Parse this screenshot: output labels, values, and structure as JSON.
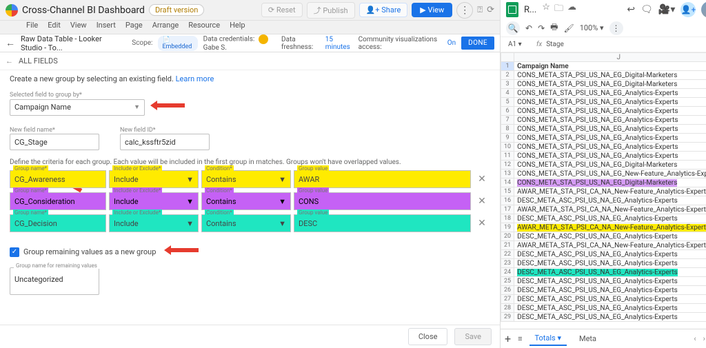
{
  "looker": {
    "title": "Cross-Channel BI Dashboard",
    "draft": "Draft version",
    "menus": [
      "File",
      "Edit",
      "View",
      "Insert",
      "Page",
      "Arrange",
      "Resource",
      "Help"
    ],
    "reset": "Reset",
    "publish": "Publish",
    "share": "Share",
    "view": "View",
    "datasource": "Raw Data Table - Looker Studio - To...",
    "scope_lbl": "Scope:",
    "scope_val": "Embedded",
    "cred_lbl": "Data credentials:",
    "cred_name": "Gabe S.",
    "fresh_lbl": "Data freshness:",
    "fresh_val": "15 minutes",
    "viz_lbl": "Community visualizations access:",
    "viz_val": "On",
    "done": "DONE",
    "all_fields": "ALL FIELDS",
    "desc": "Create a new group by selecting an existing field.",
    "learn": "Learn more",
    "sel_lbl": "Selected field to group by*",
    "sel_val": "Campaign Name",
    "nf_name_lbl": "New field name*",
    "nf_name_val": "CG_Stage",
    "nf_id_lbl": "New field ID*",
    "nf_id_val": "calc_kssftr5zid",
    "crit": "Define the criteria for each group. Each value will be included in the first group in matches. Groups won't have overlapped values.",
    "col": {
      "name": "Group name*",
      "ie": "Include or Exclude*",
      "cond": "Condition*",
      "val": "Group value"
    },
    "groups": [
      {
        "cls": "g-yellow",
        "name": "CG_Awareness",
        "ie": "Include",
        "cond": "Contains",
        "val": "AWAR"
      },
      {
        "cls": "g-purple",
        "name": "CG_Consideration",
        "ie": "Include",
        "cond": "Contains",
        "val": "CONS"
      },
      {
        "cls": "g-teal",
        "name": "CG_Decision",
        "ie": "Include",
        "cond": "Contains",
        "val": "DESC"
      }
    ],
    "remain_lbl": "Group remaining values as a new group",
    "remain_name_lbl": "Group name for remaining values",
    "remain_name_val": "Uncategorized",
    "close": "Close",
    "save": "Save"
  },
  "sheets": {
    "title": "R...",
    "zoom": "100%",
    "cellref": "A1",
    "fx_val": "Stage",
    "colJ": "J",
    "header": "Campaign Name",
    "rows": [
      {
        "n": 2,
        "t": "CONS_META_STA_PSI_US_NA_EG_Digital-Marketers"
      },
      {
        "n": 3,
        "t": "CONS_META_STA_PSI_US_NA_EG_Digital-Marketers"
      },
      {
        "n": 4,
        "t": "CONS_META_STA_PSI_US_NA_EG_Analytics-Experts"
      },
      {
        "n": 5,
        "t": "CONS_META_STA_PSI_US_NA_EG_Analytics-Experts"
      },
      {
        "n": 6,
        "t": "CONS_META_STA_PSI_US_NA_EG_Analytics-Experts"
      },
      {
        "n": 7,
        "t": "CONS_META_STA_PSI_US_NA_EG_Analytics-Experts"
      },
      {
        "n": 8,
        "t": "CONS_META_STA_PSI_US_NA_EG_Analytics-Experts"
      },
      {
        "n": 9,
        "t": "CONS_META_STA_PSI_US_NA_EG_Analytics-Experts"
      },
      {
        "n": 10,
        "t": "CONS_META_STA_PSI_US_NA_EG_Analytics-Experts"
      },
      {
        "n": 11,
        "t": "CONS_META_STA_PSI_US_NA_EG_Analytics-Experts"
      },
      {
        "n": 12,
        "t": "CONS_META_STA_PSI_US_NA_EG_Digital-Marketers"
      },
      {
        "n": 13,
        "t": "CONS_META_STA_PSI_US_NA_EG_New-Feature_Analytics-Experts"
      },
      {
        "n": 14,
        "t": "CONS_META_STA_PSI_US_NA_EG_Digital-Marketers",
        "hl": "hl-p"
      },
      {
        "n": 15,
        "t": "AWAR_META_STA_PSI_CA_NA_New-Feature_Analytics-Experts"
      },
      {
        "n": 16,
        "t": "DESC_META_ASC_PSI_US_NA_EG_Analytics-Experts"
      },
      {
        "n": 17,
        "t": "AWAR_META_STA_PSI_CA_NA_New-Feature_Analytics-Experts"
      },
      {
        "n": 18,
        "t": "DESC_META_ASC_PSI_US_NA_EG_Analytics-Experts"
      },
      {
        "n": 19,
        "t": "AWAR_META_STA_PSI_CA_NA_New-Feature_Analytics-Experts",
        "hl": "hl-y"
      },
      {
        "n": 20,
        "t": "DESC_META_ASC_PSI_US_NA_EG_Analytics-Experts"
      },
      {
        "n": 21,
        "t": "AWAR_META_STA_PSI_CA_NA_New-Feature_Analytics-Experts"
      },
      {
        "n": 22,
        "t": "DESC_META_ASC_PSI_US_NA_EG_Analytics-Experts"
      },
      {
        "n": 23,
        "t": "DESC_META_ASC_PSI_US_NA_EG_Analytics-Experts"
      },
      {
        "n": 24,
        "t": "DESC_META_ASC_PSI_US_NA_EG_Analytics-Experts",
        "hl": "hl-t"
      },
      {
        "n": 25,
        "t": "DESC_META_ASC_PSI_US_NA_EG_Analytics-Experts"
      },
      {
        "n": 26,
        "t": "DESC_META_ASC_PSI_US_NA_EG_Analytics-Experts"
      },
      {
        "n": 27,
        "t": "DESC_META_ASC_PSI_US_NA_EG_Analytics-Experts"
      },
      {
        "n": 28,
        "t": "DESC_META_ASC_PSI_US_NA_EG_Analytics-Experts"
      },
      {
        "n": 29,
        "t": "DESC_META_ASC_PSI_US_NA_EG_Analytics-Experts"
      }
    ],
    "tabs": {
      "totals": "Totals",
      "meta": "Meta"
    }
  }
}
